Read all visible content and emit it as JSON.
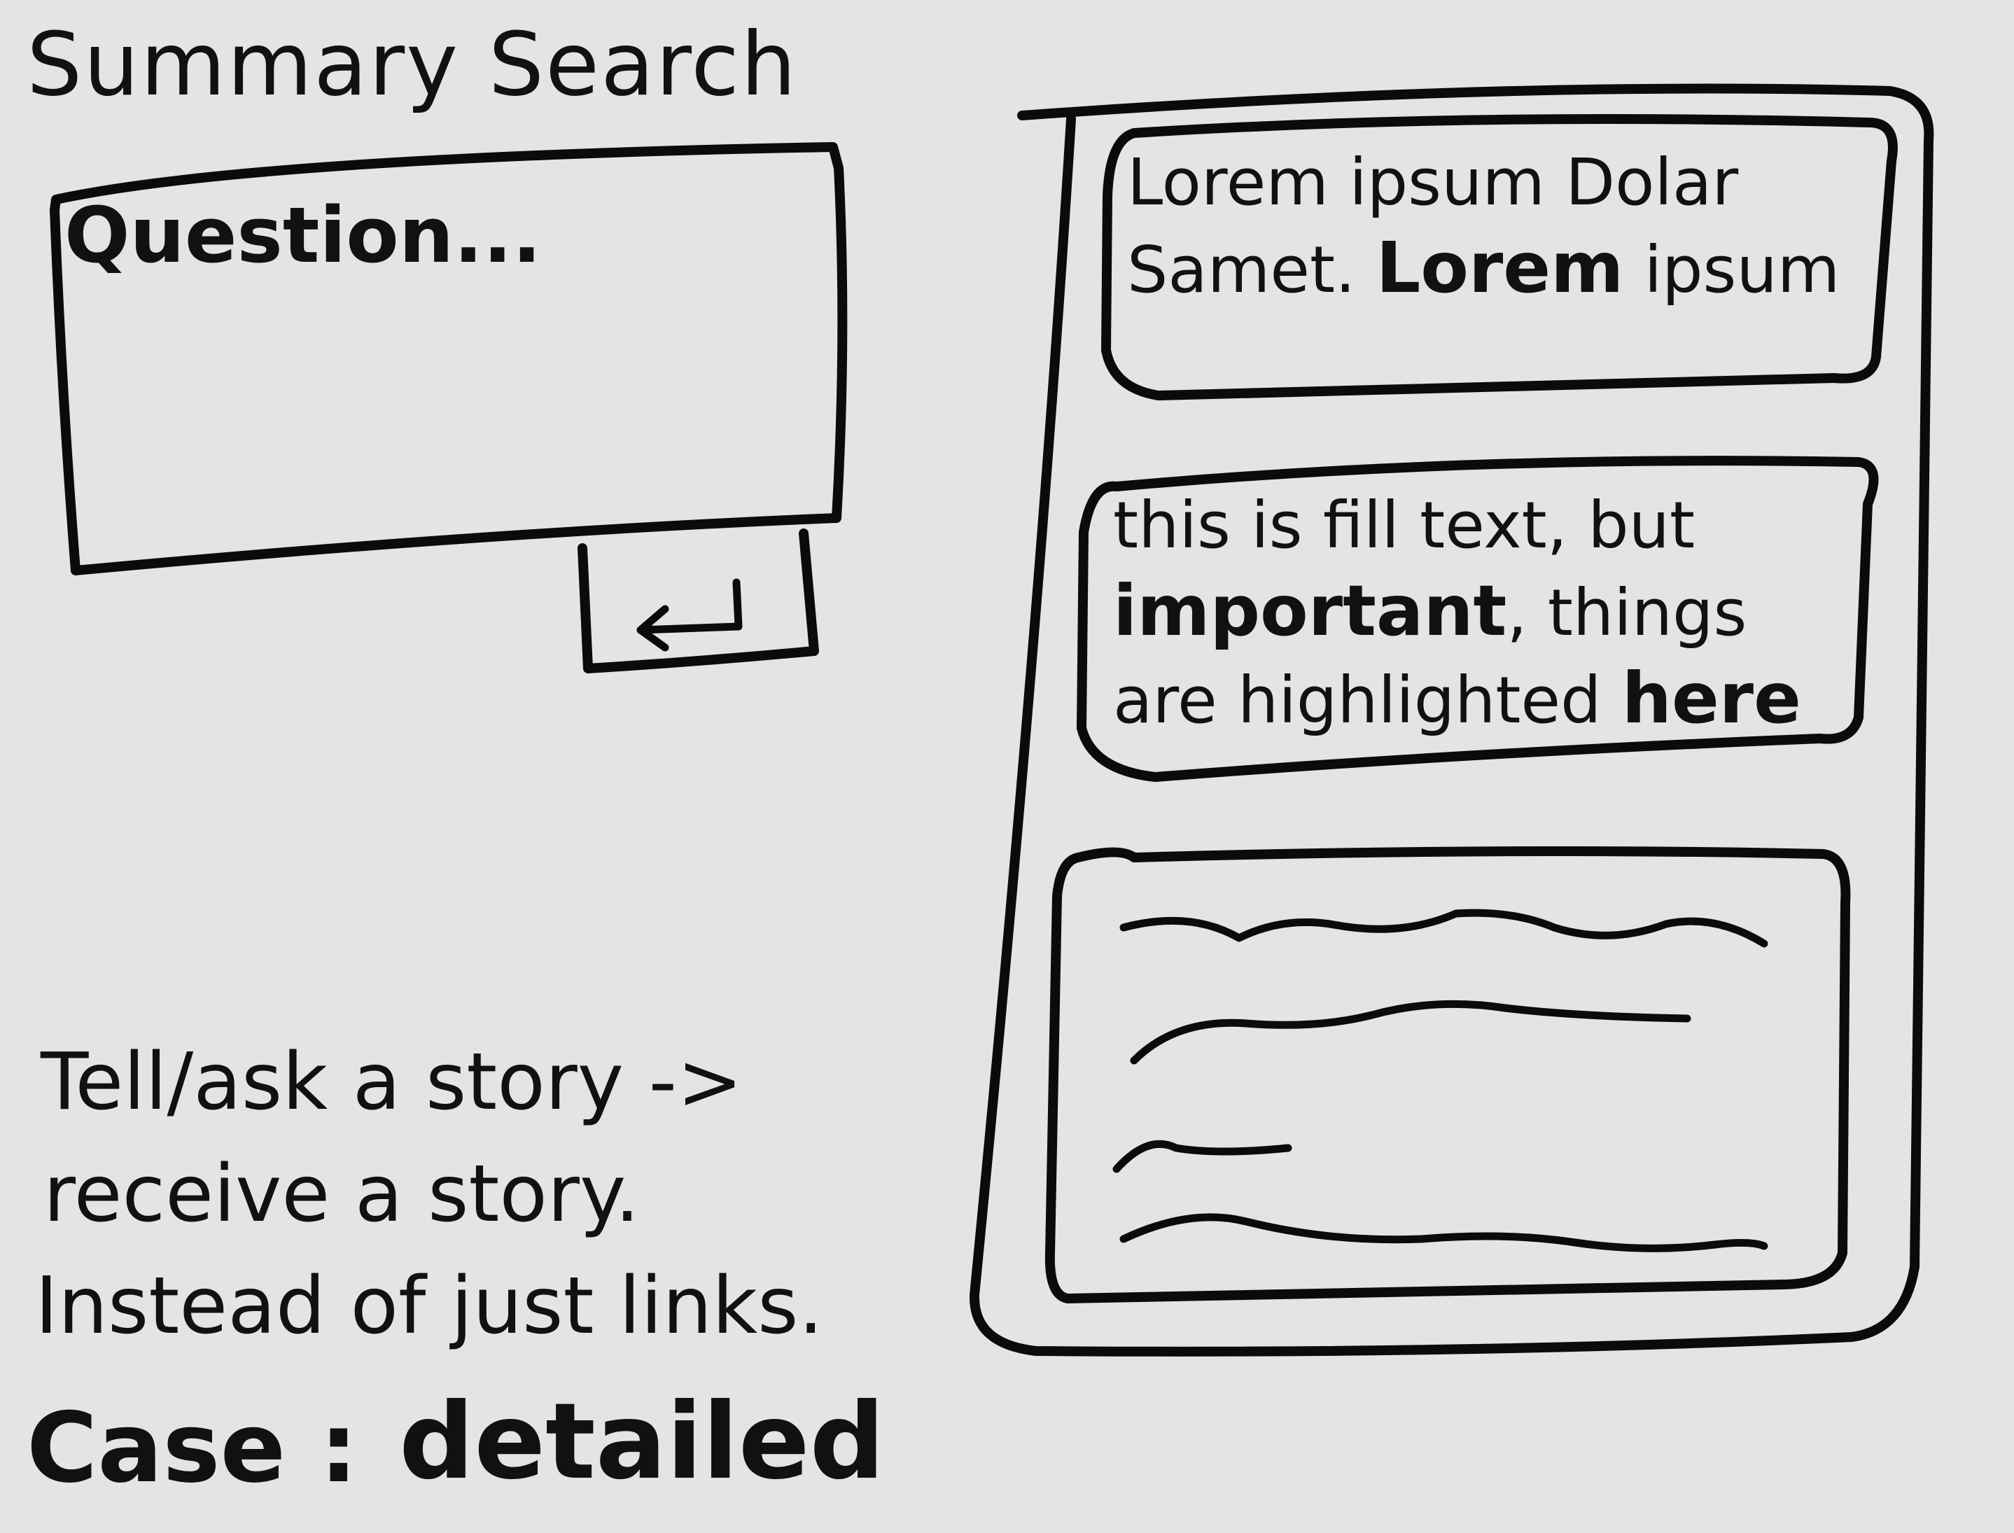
{
  "app": {
    "title": "Summary Search"
  },
  "search": {
    "placeholder": "Question...",
    "submit_icon": "enter-icon"
  },
  "results": [
    {
      "segments": [
        {
          "text": "Lorem ipsum Dolar Samet. ",
          "bold": false
        },
        {
          "text": "Lorem",
          "bold": true
        },
        {
          "text": " ipsum",
          "bold": false
        }
      ]
    },
    {
      "segments": [
        {
          "text": "this is fill text, but ",
          "bold": false
        },
        {
          "text": "important",
          "bold": true
        },
        {
          "text": ", things are highlighted ",
          "bold": false
        },
        {
          "text": "here",
          "bold": true
        }
      ]
    },
    {
      "placeholder_lines": 4
    }
  ],
  "notes": {
    "line_1": "Tell/ask a story ->",
    "line_2": "receive a story.",
    "line_3": "Instead of just links."
  },
  "case": {
    "label": "Case :",
    "value": "detailed"
  }
}
